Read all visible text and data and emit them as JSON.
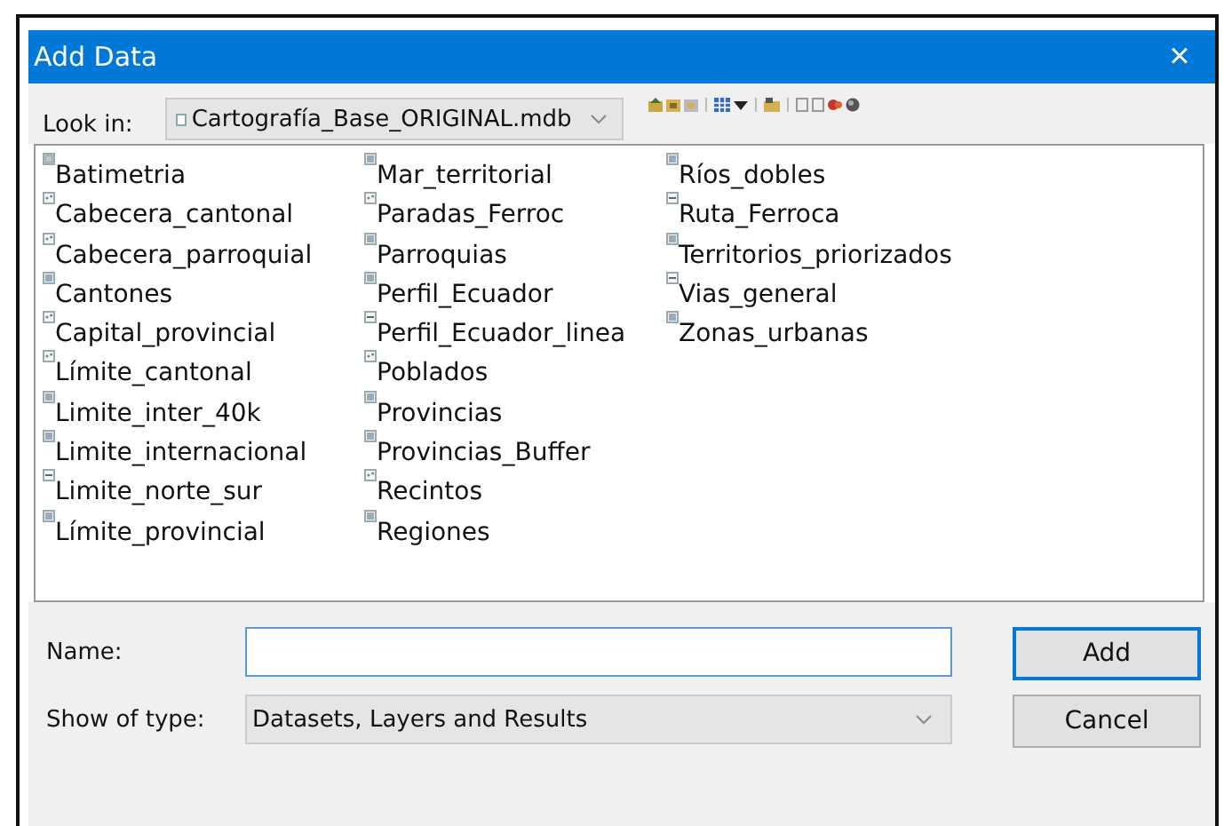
{
  "window": {
    "title": "Add Data",
    "close": "×"
  },
  "look_in": {
    "label": "Look in:",
    "value": "Cartografía_Base_ORIGINAL.mdb"
  },
  "columns": [
    [
      {
        "name": "Batimetria",
        "kind": "raster"
      },
      {
        "name": "Cabecera_cantonal",
        "kind": "point"
      },
      {
        "name": "Cabecera_parroquial",
        "kind": "point"
      },
      {
        "name": "Cantones",
        "kind": "polygon"
      },
      {
        "name": "Capital_provincial",
        "kind": "point"
      },
      {
        "name": "Límite_cantonal",
        "kind": "point"
      },
      {
        "name": "Limite_inter_40k",
        "kind": "polygon"
      },
      {
        "name": "Limite_internacional",
        "kind": "polygon"
      },
      {
        "name": "Limite_norte_sur",
        "kind": "line"
      },
      {
        "name": "Límite_provincial",
        "kind": "polygon"
      }
    ],
    [
      {
        "name": "Mar_territorial",
        "kind": "polygon"
      },
      {
        "name": "Paradas_Ferroc",
        "kind": "point"
      },
      {
        "name": "Parroquias",
        "kind": "polygon"
      },
      {
        "name": "Perfil_Ecuador",
        "kind": "polygon"
      },
      {
        "name": "Perfil_Ecuador_linea",
        "kind": "line"
      },
      {
        "name": "Poblados",
        "kind": "point"
      },
      {
        "name": "Provincias",
        "kind": "polygon"
      },
      {
        "name": "Provincias_Buffer",
        "kind": "polygon"
      },
      {
        "name": "Recintos",
        "kind": "point"
      },
      {
        "name": "Regiones",
        "kind": "polygon"
      }
    ],
    [
      {
        "name": "Ríos_dobles",
        "kind": "polygon"
      },
      {
        "name": "Ruta_Ferroca",
        "kind": "line"
      },
      {
        "name": "Territorios_priorizados",
        "kind": "polygon"
      },
      {
        "name": "Vias_general",
        "kind": "line"
      },
      {
        "name": "Zonas_urbanas",
        "kind": "polygon"
      }
    ]
  ],
  "name_field": {
    "label": "Name:"
  },
  "type_field": {
    "label": "Show of type:",
    "value": "Datasets, Layers and Results"
  },
  "buttons": [
    "Add",
    "Cancel"
  ]
}
